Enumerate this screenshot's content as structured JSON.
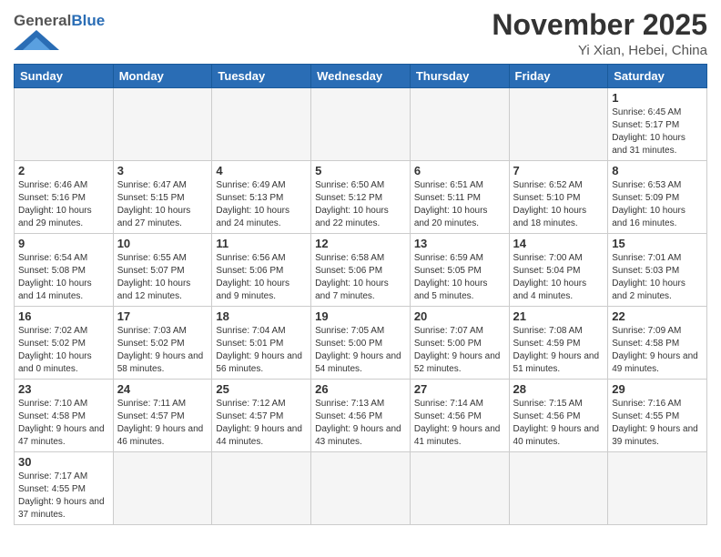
{
  "header": {
    "logo_general": "General",
    "logo_blue": "Blue",
    "month_title": "November 2025",
    "location": "Yi Xian, Hebei, China"
  },
  "days_of_week": [
    "Sunday",
    "Monday",
    "Tuesday",
    "Wednesday",
    "Thursday",
    "Friday",
    "Saturday"
  ],
  "weeks": [
    [
      {
        "day": "",
        "info": ""
      },
      {
        "day": "",
        "info": ""
      },
      {
        "day": "",
        "info": ""
      },
      {
        "day": "",
        "info": ""
      },
      {
        "day": "",
        "info": ""
      },
      {
        "day": "",
        "info": ""
      },
      {
        "day": "1",
        "info": "Sunrise: 6:45 AM\nSunset: 5:17 PM\nDaylight: 10 hours\nand 31 minutes."
      }
    ],
    [
      {
        "day": "2",
        "info": "Sunrise: 6:46 AM\nSunset: 5:16 PM\nDaylight: 10 hours\nand 29 minutes."
      },
      {
        "day": "3",
        "info": "Sunrise: 6:47 AM\nSunset: 5:15 PM\nDaylight: 10 hours\nand 27 minutes."
      },
      {
        "day": "4",
        "info": "Sunrise: 6:49 AM\nSunset: 5:13 PM\nDaylight: 10 hours\nand 24 minutes."
      },
      {
        "day": "5",
        "info": "Sunrise: 6:50 AM\nSunset: 5:12 PM\nDaylight: 10 hours\nand 22 minutes."
      },
      {
        "day": "6",
        "info": "Sunrise: 6:51 AM\nSunset: 5:11 PM\nDaylight: 10 hours\nand 20 minutes."
      },
      {
        "day": "7",
        "info": "Sunrise: 6:52 AM\nSunset: 5:10 PM\nDaylight: 10 hours\nand 18 minutes."
      },
      {
        "day": "8",
        "info": "Sunrise: 6:53 AM\nSunset: 5:09 PM\nDaylight: 10 hours\nand 16 minutes."
      }
    ],
    [
      {
        "day": "9",
        "info": "Sunrise: 6:54 AM\nSunset: 5:08 PM\nDaylight: 10 hours\nand 14 minutes."
      },
      {
        "day": "10",
        "info": "Sunrise: 6:55 AM\nSunset: 5:07 PM\nDaylight: 10 hours\nand 12 minutes."
      },
      {
        "day": "11",
        "info": "Sunrise: 6:56 AM\nSunset: 5:06 PM\nDaylight: 10 hours\nand 9 minutes."
      },
      {
        "day": "12",
        "info": "Sunrise: 6:58 AM\nSunset: 5:06 PM\nDaylight: 10 hours\nand 7 minutes."
      },
      {
        "day": "13",
        "info": "Sunrise: 6:59 AM\nSunset: 5:05 PM\nDaylight: 10 hours\nand 5 minutes."
      },
      {
        "day": "14",
        "info": "Sunrise: 7:00 AM\nSunset: 5:04 PM\nDaylight: 10 hours\nand 4 minutes."
      },
      {
        "day": "15",
        "info": "Sunrise: 7:01 AM\nSunset: 5:03 PM\nDaylight: 10 hours\nand 2 minutes."
      }
    ],
    [
      {
        "day": "16",
        "info": "Sunrise: 7:02 AM\nSunset: 5:02 PM\nDaylight: 10 hours\nand 0 minutes."
      },
      {
        "day": "17",
        "info": "Sunrise: 7:03 AM\nSunset: 5:02 PM\nDaylight: 9 hours\nand 58 minutes."
      },
      {
        "day": "18",
        "info": "Sunrise: 7:04 AM\nSunset: 5:01 PM\nDaylight: 9 hours\nand 56 minutes."
      },
      {
        "day": "19",
        "info": "Sunrise: 7:05 AM\nSunset: 5:00 PM\nDaylight: 9 hours\nand 54 minutes."
      },
      {
        "day": "20",
        "info": "Sunrise: 7:07 AM\nSunset: 5:00 PM\nDaylight: 9 hours\nand 52 minutes."
      },
      {
        "day": "21",
        "info": "Sunrise: 7:08 AM\nSunset: 4:59 PM\nDaylight: 9 hours\nand 51 minutes."
      },
      {
        "day": "22",
        "info": "Sunrise: 7:09 AM\nSunset: 4:58 PM\nDaylight: 9 hours\nand 49 minutes."
      }
    ],
    [
      {
        "day": "23",
        "info": "Sunrise: 7:10 AM\nSunset: 4:58 PM\nDaylight: 9 hours\nand 47 minutes."
      },
      {
        "day": "24",
        "info": "Sunrise: 7:11 AM\nSunset: 4:57 PM\nDaylight: 9 hours\nand 46 minutes."
      },
      {
        "day": "25",
        "info": "Sunrise: 7:12 AM\nSunset: 4:57 PM\nDaylight: 9 hours\nand 44 minutes."
      },
      {
        "day": "26",
        "info": "Sunrise: 7:13 AM\nSunset: 4:56 PM\nDaylight: 9 hours\nand 43 minutes."
      },
      {
        "day": "27",
        "info": "Sunrise: 7:14 AM\nSunset: 4:56 PM\nDaylight: 9 hours\nand 41 minutes."
      },
      {
        "day": "28",
        "info": "Sunrise: 7:15 AM\nSunset: 4:56 PM\nDaylight: 9 hours\nand 40 minutes."
      },
      {
        "day": "29",
        "info": "Sunrise: 7:16 AM\nSunset: 4:55 PM\nDaylight: 9 hours\nand 39 minutes."
      }
    ],
    [
      {
        "day": "30",
        "info": "Sunrise: 7:17 AM\nSunset: 4:55 PM\nDaylight: 9 hours\nand 37 minutes."
      },
      {
        "day": "",
        "info": ""
      },
      {
        "day": "",
        "info": ""
      },
      {
        "day": "",
        "info": ""
      },
      {
        "day": "",
        "info": ""
      },
      {
        "day": "",
        "info": ""
      },
      {
        "day": "",
        "info": ""
      }
    ]
  ]
}
